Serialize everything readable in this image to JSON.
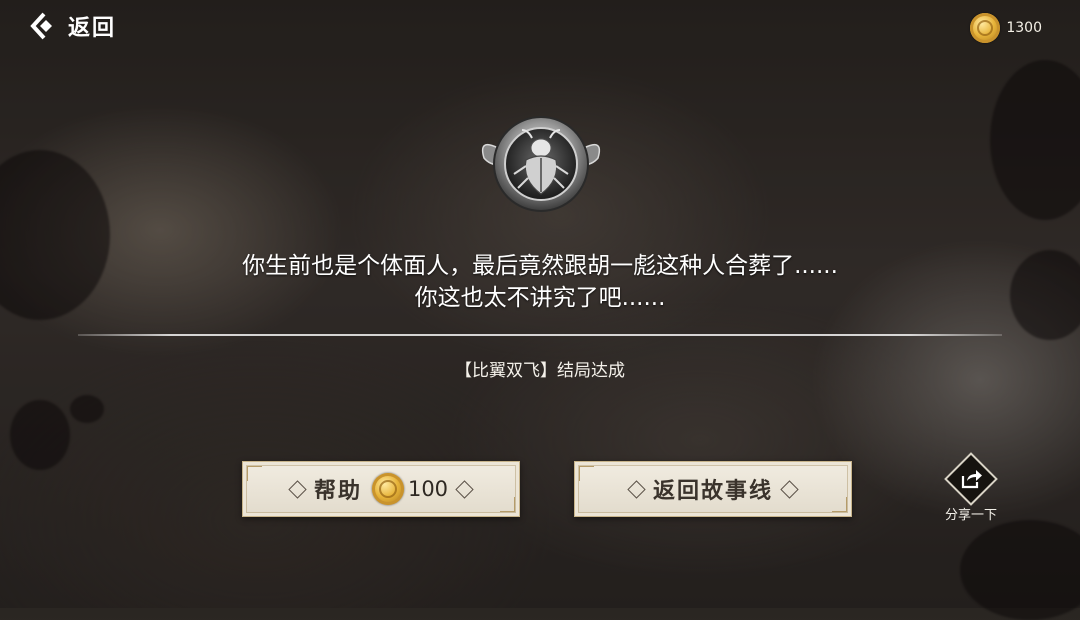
{
  "header": {
    "back_label": "返回",
    "currency": {
      "icon": "gold-coin-icon",
      "amount": "1300"
    }
  },
  "emblem": {
    "icon": "beetle-emblem-icon"
  },
  "dialogue": {
    "line1": "你生前也是个体面人，最后竟然跟胡一彪这种人合葬了......",
    "line2": "你这也太不讲究了吧......"
  },
  "ending": {
    "label": "【比翼双飞】结局达成"
  },
  "buttons": {
    "help": {
      "label": "帮助",
      "cost": "100",
      "icon": "gold-coin-icon"
    },
    "story": {
      "label": "返回故事线"
    }
  },
  "share": {
    "label": "分享一下",
    "icon": "share-arrow-icon"
  },
  "colors": {
    "button_bg": "#ece6d9",
    "button_text": "#3a332c",
    "coin_gold": "#e7b43a",
    "text_white": "#ffffff"
  }
}
